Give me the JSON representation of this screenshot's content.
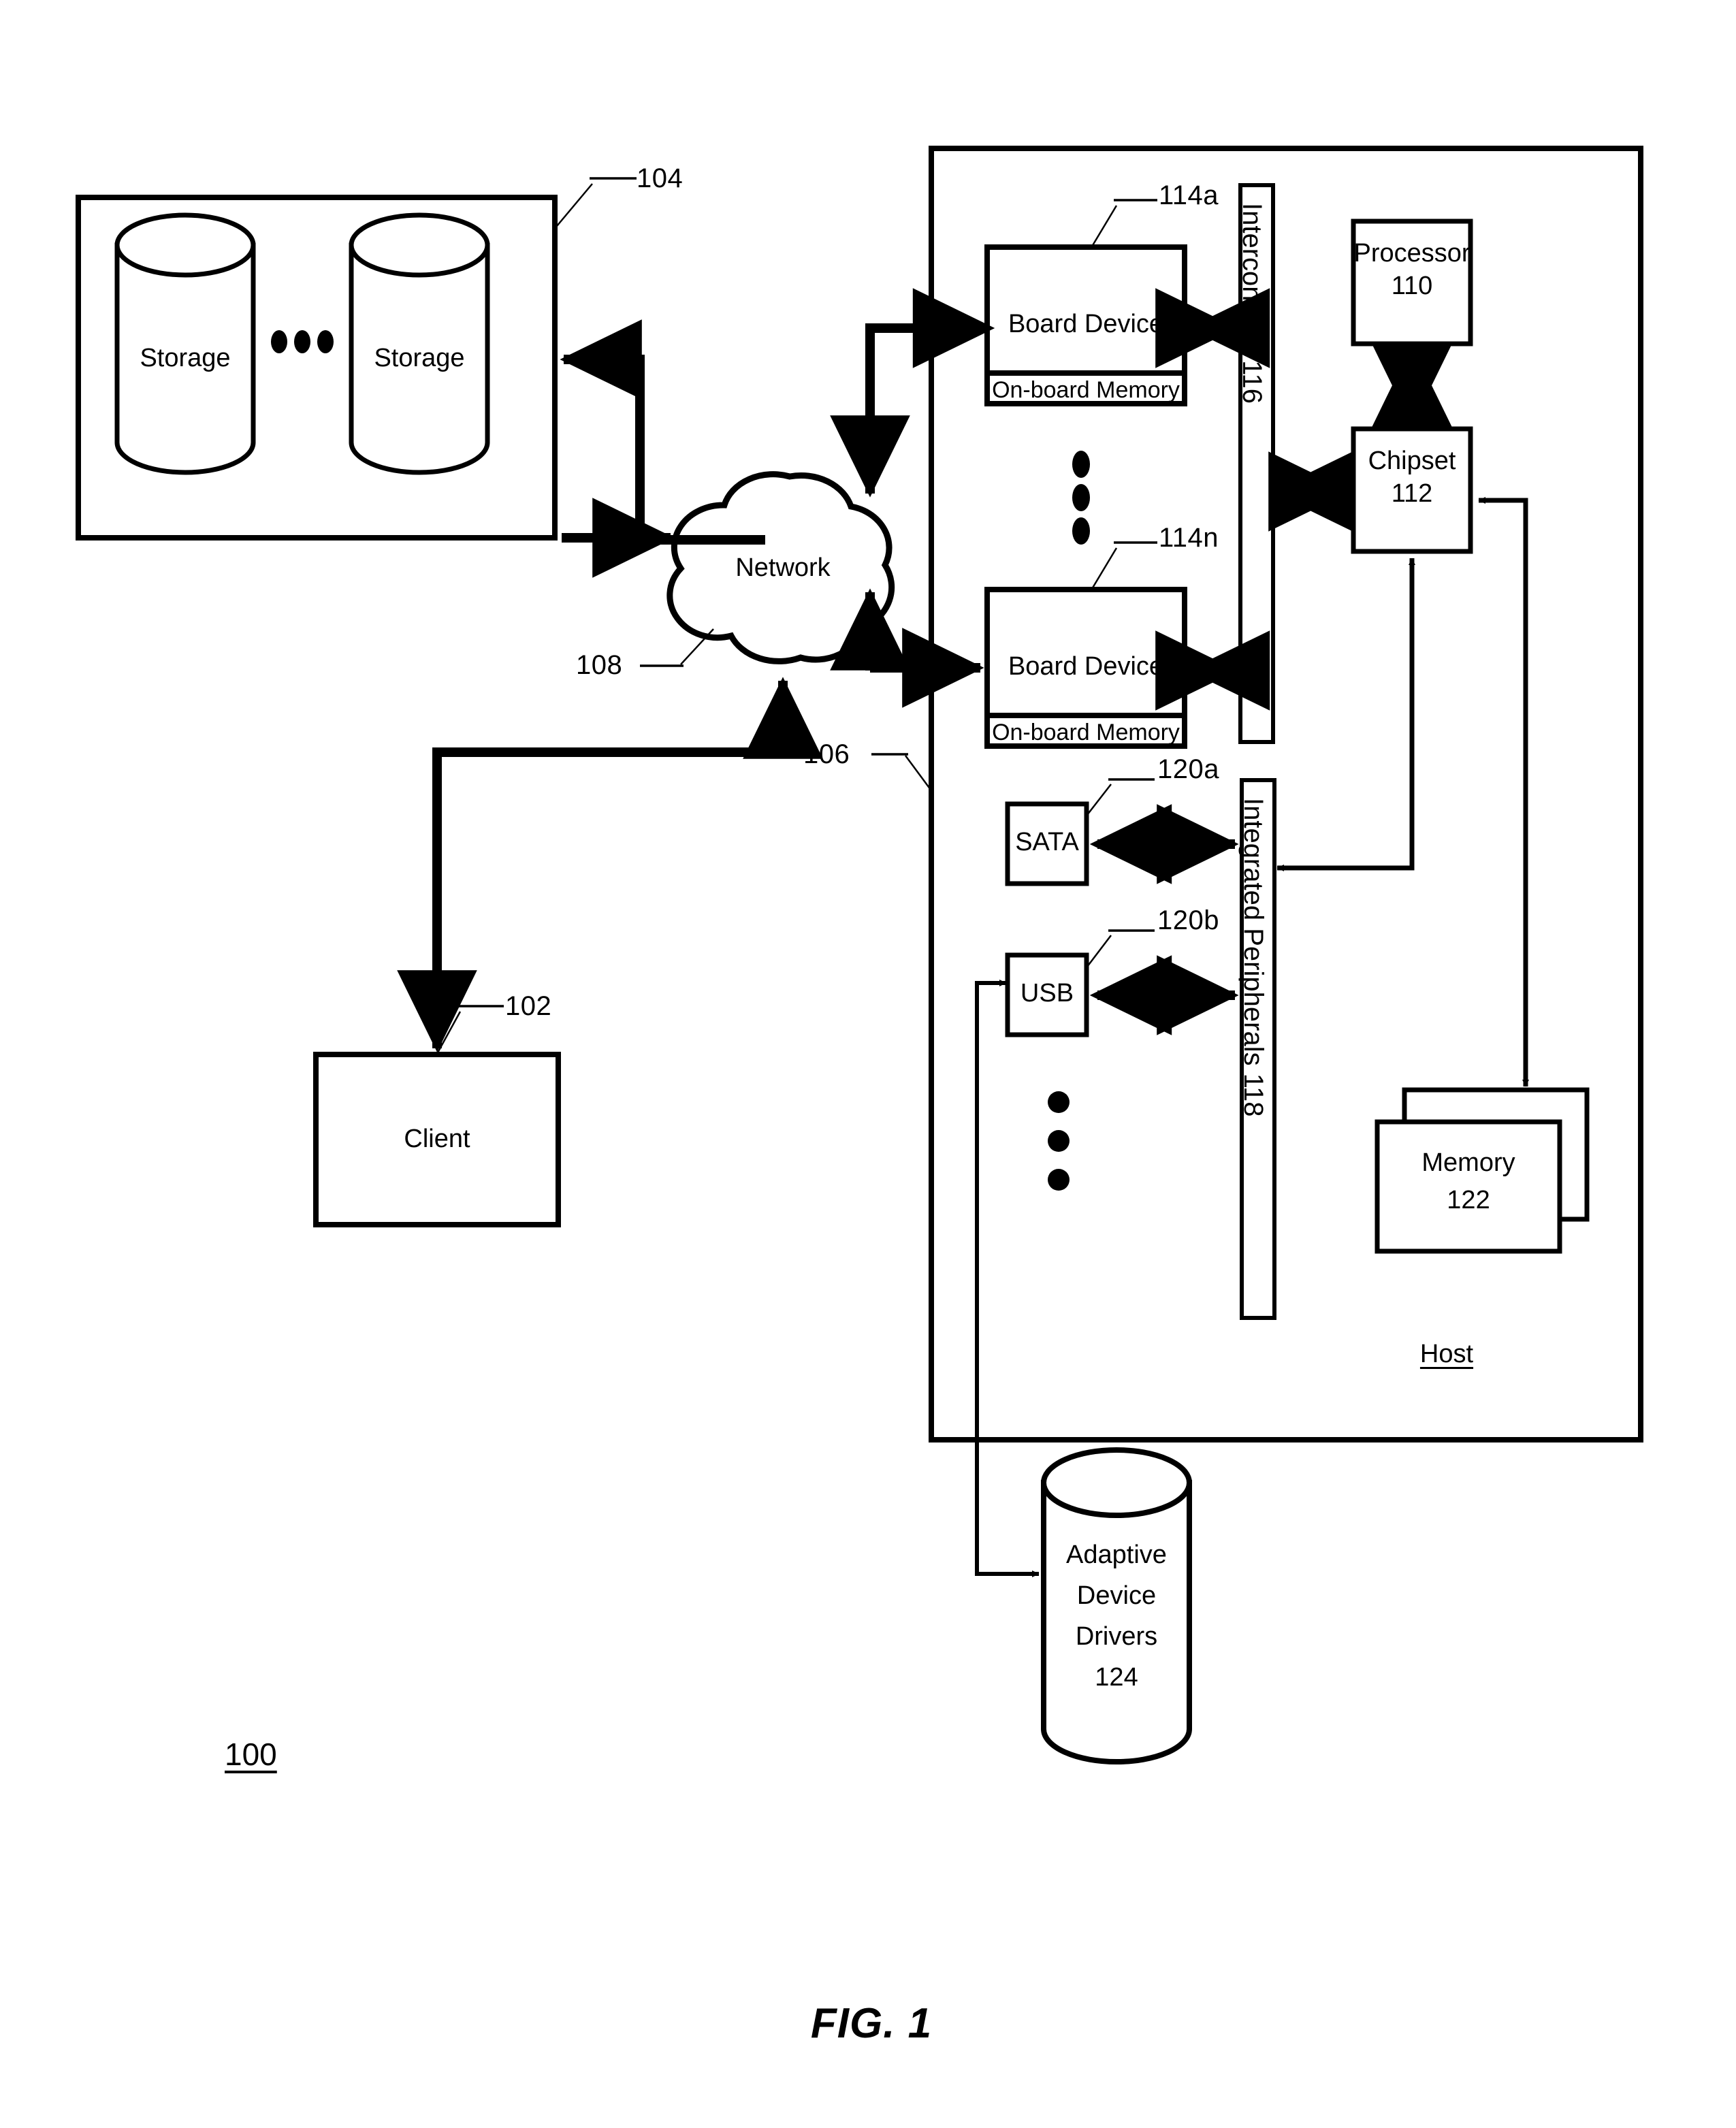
{
  "figure": {
    "caption": "FIG. 1",
    "system_ref": "100"
  },
  "blocks": {
    "storage_group": {
      "ref": "104",
      "items": [
        {
          "label": "Storage"
        },
        {
          "label": "Storage"
        }
      ],
      "ellipsis": "•••"
    },
    "network": {
      "label": "Network",
      "ref": "108"
    },
    "client": {
      "label": "Client",
      "ref": "102"
    },
    "host": {
      "label": "Host",
      "ref": "106"
    },
    "board_devices": [
      {
        "label": "Board Device",
        "memory_label": "On-board Memory",
        "ref": "114a"
      },
      {
        "label": "Board Device",
        "memory_label": "On-board Memory",
        "ref": "114n"
      }
    ],
    "interconnect": {
      "label": "Interconnect 116"
    },
    "processor": {
      "label": "Processor",
      "ref": "110"
    },
    "chipset": {
      "label": "Chipset",
      "ref": "112"
    },
    "memory": {
      "label": "Memory",
      "ref": "122"
    },
    "integrated_peripherals": {
      "label": "Integrated Peripherals 118"
    },
    "peripherals": [
      {
        "label": "SATA",
        "ref": "120a"
      },
      {
        "label": "USB",
        "ref": "120b"
      }
    ],
    "adaptive_device_drivers": {
      "line1": "Adaptive",
      "line2": "Device",
      "line3": "Drivers",
      "ref": "124"
    }
  },
  "colors": {
    "stroke": "#000000",
    "background": "#ffffff"
  }
}
